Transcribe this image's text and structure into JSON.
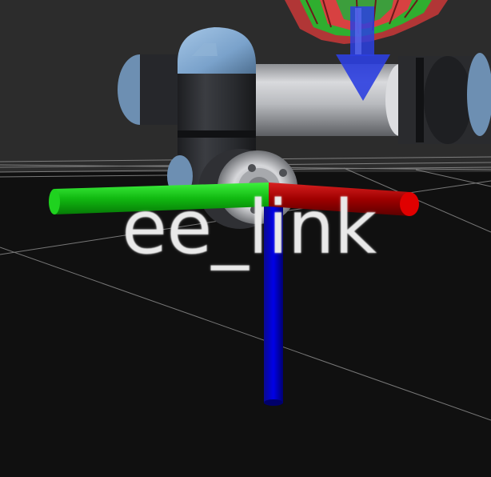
{
  "viewport": {
    "background": "#101010",
    "grid_color": "#9a9a9a"
  },
  "frame": {
    "label": "ee_link",
    "axes": {
      "x_color": "#b30000",
      "y_color": "#00c000",
      "z_color": "#0000e0"
    }
  },
  "robot": {
    "cap_color": "#7ea6cf",
    "body_color": "#2b2d31",
    "tube_color": "#c6c8cc"
  },
  "interactive_marker": {
    "ring_colors": [
      "#d13030",
      "#2fae2f",
      "#3a3ad8"
    ],
    "arrow_color": "#2c3fe0"
  },
  "icons": [
    "tcp-flange-icon",
    "rotation-ring-icon",
    "translate-arrow-icon"
  ]
}
